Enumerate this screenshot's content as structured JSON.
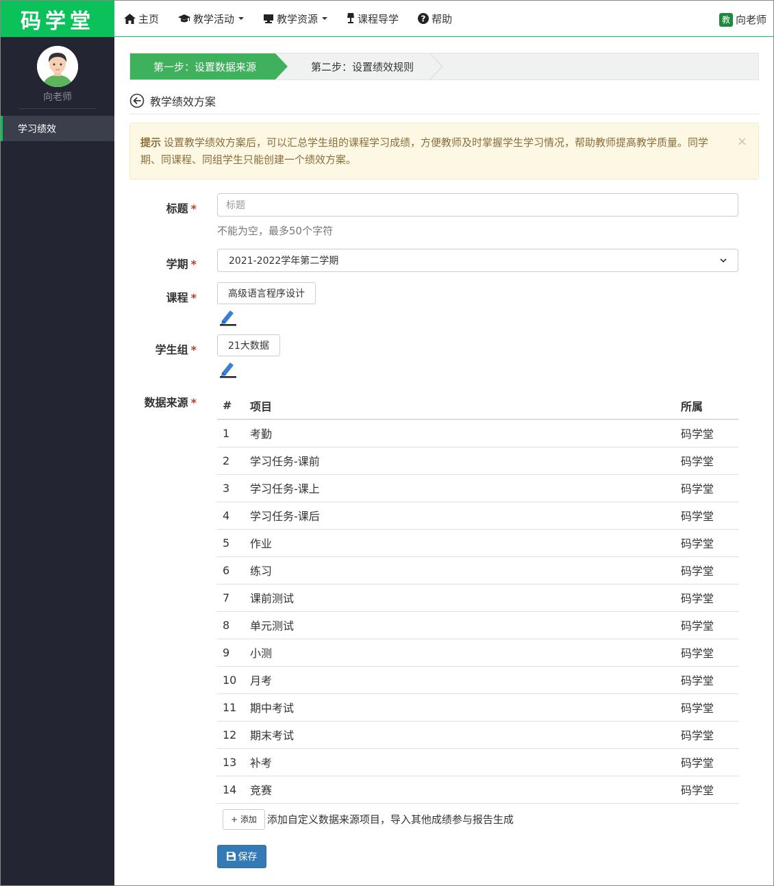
{
  "brand": {
    "logo_text": "码学堂",
    "accent": "#0bc15a"
  },
  "sidebar": {
    "user_name": "向老师",
    "items": [
      {
        "label": "学习绩效"
      }
    ]
  },
  "topnav": {
    "items": [
      {
        "label": "主页",
        "icon": "home-icon"
      },
      {
        "label": "教学活动",
        "icon": "graduation-cap-icon",
        "dropdown": true
      },
      {
        "label": "教学资源",
        "icon": "monitor-icon",
        "dropdown": true
      },
      {
        "label": "课程导学",
        "icon": "lamp-icon"
      },
      {
        "label": "帮助",
        "icon": "question-icon"
      }
    ],
    "user": {
      "badge": "教",
      "name": "向老师"
    }
  },
  "steps": {
    "step1": "第一步：设置数据来源",
    "step2": "第二步：设置绩效规则"
  },
  "page": {
    "title": "教学绩效方案"
  },
  "alert": {
    "title": "提示",
    "text": "设置教学绩效方案后，可以汇总学生组的课程学习成绩，方便教师及时掌握学生学习情况，帮助教师提高教学质量。同学期、同课程、同组学生只能创建一个绩效方案。",
    "close": "×"
  },
  "form": {
    "title_label": "标题",
    "title_placeholder": "标题",
    "title_help": "不能为空，最多50个字符",
    "term_label": "学期",
    "term_value": "2021-2022学年第二学期",
    "course_label": "课程",
    "course_value": "高级语言程序设计",
    "group_label": "学生组",
    "group_value": "21大数据",
    "source_label": "数据来源",
    "required_mark": "*"
  },
  "table": {
    "headers": {
      "num": "#",
      "item": "项目",
      "owner": "所属"
    },
    "rows": [
      {
        "num": "1",
        "item": "考勤",
        "owner": "码学堂"
      },
      {
        "num": "2",
        "item": "学习任务-课前",
        "owner": "码学堂"
      },
      {
        "num": "3",
        "item": "学习任务-课上",
        "owner": "码学堂"
      },
      {
        "num": "4",
        "item": "学习任务-课后",
        "owner": "码学堂"
      },
      {
        "num": "5",
        "item": "作业",
        "owner": "码学堂"
      },
      {
        "num": "6",
        "item": "练习",
        "owner": "码学堂"
      },
      {
        "num": "7",
        "item": "课前测试",
        "owner": "码学堂"
      },
      {
        "num": "8",
        "item": "单元测试",
        "owner": "码学堂"
      },
      {
        "num": "9",
        "item": "小测",
        "owner": "码学堂"
      },
      {
        "num": "10",
        "item": "月考",
        "owner": "码学堂"
      },
      {
        "num": "11",
        "item": "期中考试",
        "owner": "码学堂"
      },
      {
        "num": "12",
        "item": "期末考试",
        "owner": "码学堂"
      },
      {
        "num": "13",
        "item": "补考",
        "owner": "码学堂"
      },
      {
        "num": "14",
        "item": "竞赛",
        "owner": "码学堂"
      }
    ]
  },
  "add": {
    "button": "+ 添加",
    "text": "添加自定义数据来源项目，导入其他成绩参与报告生成"
  },
  "save": {
    "label": "保存"
  }
}
